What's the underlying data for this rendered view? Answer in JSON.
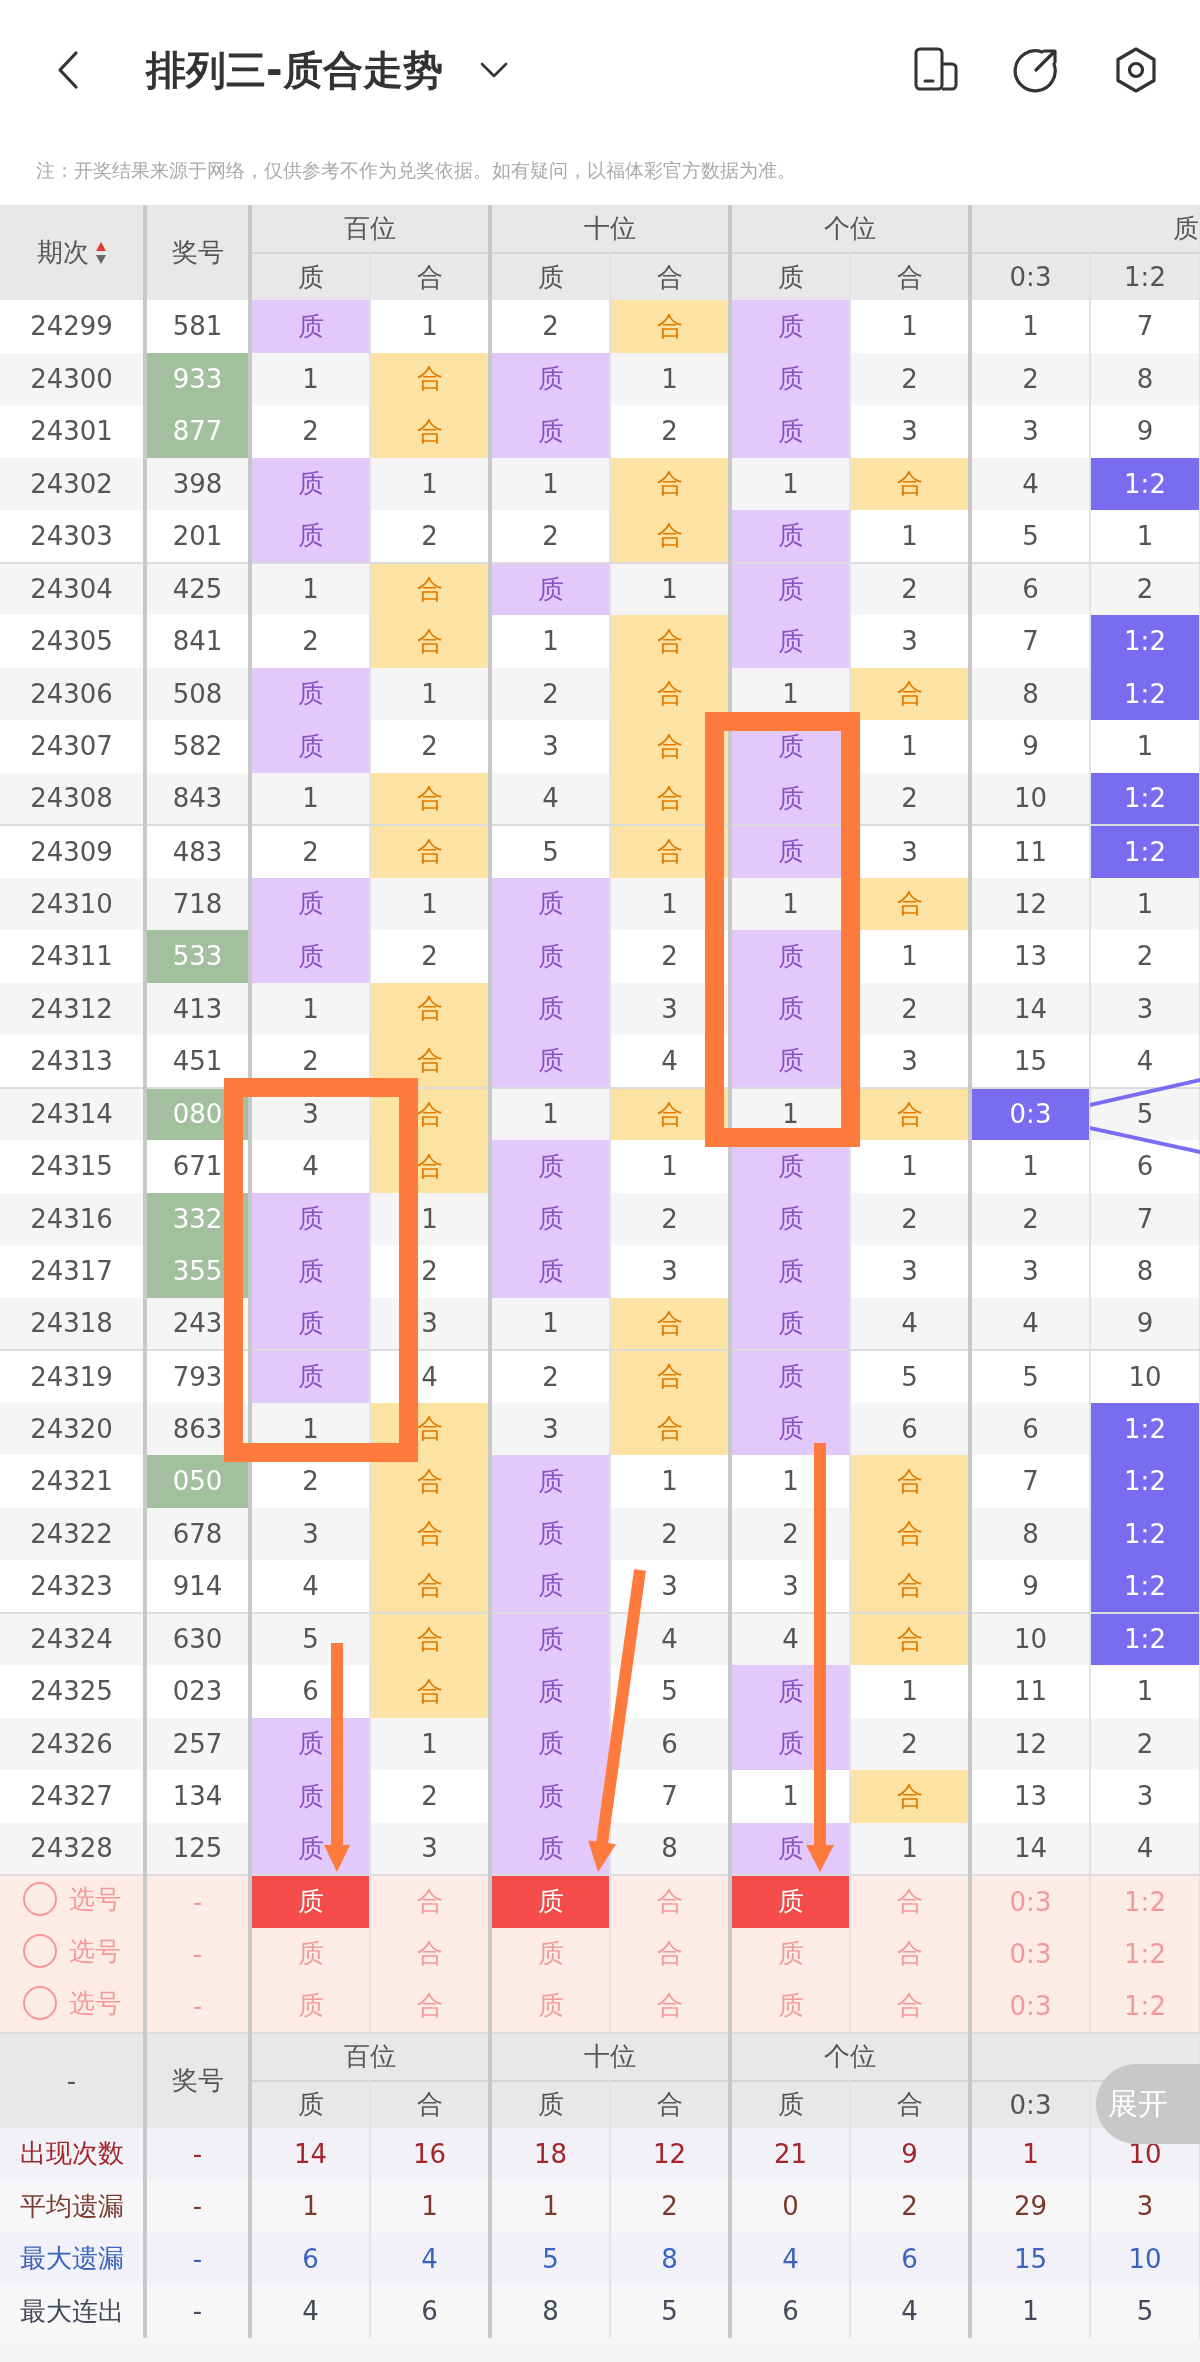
{
  "title": "排列三-质合走势",
  "note": "注：开奖结果来源于网络，仅供参考不作为兑奖依据。如有疑问，以福体彩官方数据为准。",
  "header": {
    "period": "期次",
    "prize": "奖号",
    "groups": [
      "百位",
      "十位",
      "个位"
    ],
    "ratio_group": "质",
    "sub": [
      "质",
      "合",
      "质",
      "合",
      "质",
      "合",
      "0:3",
      "1:2"
    ]
  },
  "rows": [
    {
      "period": "24299",
      "prize": "581",
      "pair": false,
      "pos": [
        {
          "kind": "prime",
          "prime": "质",
          "composite": "1"
        },
        {
          "kind": "composite",
          "prime": "2",
          "composite": "合"
        },
        {
          "kind": "prime",
          "prime": "质",
          "composite": "1"
        }
      ],
      "ratio": [
        {
          "text": "1",
          "selected": false
        },
        {
          "text": "7",
          "selected": false
        }
      ]
    },
    {
      "period": "24300",
      "prize": "933",
      "pair": true,
      "pos": [
        {
          "kind": "composite",
          "prime": "1",
          "composite": "合"
        },
        {
          "kind": "prime",
          "prime": "质",
          "composite": "1"
        },
        {
          "kind": "prime",
          "prime": "质",
          "composite": "2"
        }
      ],
      "ratio": [
        {
          "text": "2",
          "selected": false
        },
        {
          "text": "8",
          "selected": false
        }
      ]
    },
    {
      "period": "24301",
      "prize": "877",
      "pair": true,
      "pos": [
        {
          "kind": "composite",
          "prime": "2",
          "composite": "合"
        },
        {
          "kind": "prime",
          "prime": "质",
          "composite": "2"
        },
        {
          "kind": "prime",
          "prime": "质",
          "composite": "3"
        }
      ],
      "ratio": [
        {
          "text": "3",
          "selected": false
        },
        {
          "text": "9",
          "selected": false
        }
      ]
    },
    {
      "period": "24302",
      "prize": "398",
      "pair": false,
      "pos": [
        {
          "kind": "prime",
          "prime": "质",
          "composite": "1"
        },
        {
          "kind": "composite",
          "prime": "1",
          "composite": "合"
        },
        {
          "kind": "composite",
          "prime": "1",
          "composite": "合"
        }
      ],
      "ratio": [
        {
          "text": "4",
          "selected": false
        },
        {
          "text": "1:2",
          "selected": true
        }
      ]
    },
    {
      "period": "24303",
      "prize": "201",
      "pair": false,
      "pos": [
        {
          "kind": "prime",
          "prime": "质",
          "composite": "2"
        },
        {
          "kind": "composite",
          "prime": "2",
          "composite": "合"
        },
        {
          "kind": "prime",
          "prime": "质",
          "composite": "1"
        }
      ],
      "ratio": [
        {
          "text": "5",
          "selected": false
        },
        {
          "text": "1",
          "selected": false
        }
      ]
    },
    {
      "period": "24304",
      "prize": "425",
      "pair": false,
      "pos": [
        {
          "kind": "composite",
          "prime": "1",
          "composite": "合"
        },
        {
          "kind": "prime",
          "prime": "质",
          "composite": "1"
        },
        {
          "kind": "prime",
          "prime": "质",
          "composite": "2"
        }
      ],
      "ratio": [
        {
          "text": "6",
          "selected": false
        },
        {
          "text": "2",
          "selected": false
        }
      ]
    },
    {
      "period": "24305",
      "prize": "841",
      "pair": false,
      "pos": [
        {
          "kind": "composite",
          "prime": "2",
          "composite": "合"
        },
        {
          "kind": "composite",
          "prime": "1",
          "composite": "合"
        },
        {
          "kind": "prime",
          "prime": "质",
          "composite": "3"
        }
      ],
      "ratio": [
        {
          "text": "7",
          "selected": false
        },
        {
          "text": "1:2",
          "selected": true
        }
      ]
    },
    {
      "period": "24306",
      "prize": "508",
      "pair": false,
      "pos": [
        {
          "kind": "prime",
          "prime": "质",
          "composite": "1"
        },
        {
          "kind": "composite",
          "prime": "2",
          "composite": "合"
        },
        {
          "kind": "composite",
          "prime": "1",
          "composite": "合"
        }
      ],
      "ratio": [
        {
          "text": "8",
          "selected": false
        },
        {
          "text": "1:2",
          "selected": true
        }
      ]
    },
    {
      "period": "24307",
      "prize": "582",
      "pair": false,
      "pos": [
        {
          "kind": "prime",
          "prime": "质",
          "composite": "2"
        },
        {
          "kind": "composite",
          "prime": "3",
          "composite": "合"
        },
        {
          "kind": "prime",
          "prime": "质",
          "composite": "1"
        }
      ],
      "ratio": [
        {
          "text": "9",
          "selected": false
        },
        {
          "text": "1",
          "selected": false
        }
      ]
    },
    {
      "period": "24308",
      "prize": "843",
      "pair": false,
      "pos": [
        {
          "kind": "composite",
          "prime": "1",
          "composite": "合"
        },
        {
          "kind": "composite",
          "prime": "4",
          "composite": "合"
        },
        {
          "kind": "prime",
          "prime": "质",
          "composite": "2"
        }
      ],
      "ratio": [
        {
          "text": "10",
          "selected": false
        },
        {
          "text": "1:2",
          "selected": true
        }
      ]
    },
    {
      "period": "24309",
      "prize": "483",
      "pair": false,
      "pos": [
        {
          "kind": "composite",
          "prime": "2",
          "composite": "合"
        },
        {
          "kind": "composite",
          "prime": "5",
          "composite": "合"
        },
        {
          "kind": "prime",
          "prime": "质",
          "composite": "3"
        }
      ],
      "ratio": [
        {
          "text": "11",
          "selected": false
        },
        {
          "text": "1:2",
          "selected": true
        }
      ]
    },
    {
      "period": "24310",
      "prize": "718",
      "pair": false,
      "pos": [
        {
          "kind": "prime",
          "prime": "质",
          "composite": "1"
        },
        {
          "kind": "prime",
          "prime": "质",
          "composite": "1"
        },
        {
          "kind": "composite",
          "prime": "1",
          "composite": "合"
        }
      ],
      "ratio": [
        {
          "text": "12",
          "selected": false
        },
        {
          "text": "1",
          "selected": false
        }
      ]
    },
    {
      "period": "24311",
      "prize": "533",
      "pair": true,
      "pos": [
        {
          "kind": "prime",
          "prime": "质",
          "composite": "2"
        },
        {
          "kind": "prime",
          "prime": "质",
          "composite": "2"
        },
        {
          "kind": "prime",
          "prime": "质",
          "composite": "1"
        }
      ],
      "ratio": [
        {
          "text": "13",
          "selected": false
        },
        {
          "text": "2",
          "selected": false
        }
      ]
    },
    {
      "period": "24312",
      "prize": "413",
      "pair": false,
      "pos": [
        {
          "kind": "composite",
          "prime": "1",
          "composite": "合"
        },
        {
          "kind": "prime",
          "prime": "质",
          "composite": "3"
        },
        {
          "kind": "prime",
          "prime": "质",
          "composite": "2"
        }
      ],
      "ratio": [
        {
          "text": "14",
          "selected": false
        },
        {
          "text": "3",
          "selected": false
        }
      ]
    },
    {
      "period": "24313",
      "prize": "451",
      "pair": false,
      "pos": [
        {
          "kind": "composite",
          "prime": "2",
          "composite": "合"
        },
        {
          "kind": "prime",
          "prime": "质",
          "composite": "4"
        },
        {
          "kind": "prime",
          "prime": "质",
          "composite": "3"
        }
      ],
      "ratio": [
        {
          "text": "15",
          "selected": false
        },
        {
          "text": "4",
          "selected": false
        }
      ]
    },
    {
      "period": "24314",
      "prize": "080",
      "pair": true,
      "pos": [
        {
          "kind": "composite",
          "prime": "3",
          "composite": "合"
        },
        {
          "kind": "composite",
          "prime": "1",
          "composite": "合"
        },
        {
          "kind": "composite",
          "prime": "1",
          "composite": "合"
        }
      ],
      "ratio": [
        {
          "text": "0:3",
          "selected": true
        },
        {
          "text": "5",
          "selected": false
        }
      ]
    },
    {
      "period": "24315",
      "prize": "671",
      "pair": false,
      "pos": [
        {
          "kind": "composite",
          "prime": "4",
          "composite": "合"
        },
        {
          "kind": "prime",
          "prime": "质",
          "composite": "1"
        },
        {
          "kind": "prime",
          "prime": "质",
          "composite": "1"
        }
      ],
      "ratio": [
        {
          "text": "1",
          "selected": false
        },
        {
          "text": "6",
          "selected": false
        }
      ]
    },
    {
      "period": "24316",
      "prize": "332",
      "pair": true,
      "pos": [
        {
          "kind": "prime",
          "prime": "质",
          "composite": "1"
        },
        {
          "kind": "prime",
          "prime": "质",
          "composite": "2"
        },
        {
          "kind": "prime",
          "prime": "质",
          "composite": "2"
        }
      ],
      "ratio": [
        {
          "text": "2",
          "selected": false
        },
        {
          "text": "7",
          "selected": false
        }
      ]
    },
    {
      "period": "24317",
      "prize": "355",
      "pair": true,
      "pos": [
        {
          "kind": "prime",
          "prime": "质",
          "composite": "2"
        },
        {
          "kind": "prime",
          "prime": "质",
          "composite": "3"
        },
        {
          "kind": "prime",
          "prime": "质",
          "composite": "3"
        }
      ],
      "ratio": [
        {
          "text": "3",
          "selected": false
        },
        {
          "text": "8",
          "selected": false
        }
      ]
    },
    {
      "period": "24318",
      "prize": "243",
      "pair": false,
      "pos": [
        {
          "kind": "prime",
          "prime": "质",
          "composite": "3"
        },
        {
          "kind": "composite",
          "prime": "1",
          "composite": "合"
        },
        {
          "kind": "prime",
          "prime": "质",
          "composite": "4"
        }
      ],
      "ratio": [
        {
          "text": "4",
          "selected": false
        },
        {
          "text": "9",
          "selected": false
        }
      ]
    },
    {
      "period": "24319",
      "prize": "793",
      "pair": false,
      "pos": [
        {
          "kind": "prime",
          "prime": "质",
          "composite": "4"
        },
        {
          "kind": "composite",
          "prime": "2",
          "composite": "合"
        },
        {
          "kind": "prime",
          "prime": "质",
          "composite": "5"
        }
      ],
      "ratio": [
        {
          "text": "5",
          "selected": false
        },
        {
          "text": "10",
          "selected": false
        }
      ]
    },
    {
      "period": "24320",
      "prize": "863",
      "pair": false,
      "pos": [
        {
          "kind": "composite",
          "prime": "1",
          "composite": "合"
        },
        {
          "kind": "composite",
          "prime": "3",
          "composite": "合"
        },
        {
          "kind": "prime",
          "prime": "质",
          "composite": "6"
        }
      ],
      "ratio": [
        {
          "text": "6",
          "selected": false
        },
        {
          "text": "1:2",
          "selected": true
        }
      ]
    },
    {
      "period": "24321",
      "prize": "050",
      "pair": true,
      "pos": [
        {
          "kind": "composite",
          "prime": "2",
          "composite": "合"
        },
        {
          "kind": "prime",
          "prime": "质",
          "composite": "1"
        },
        {
          "kind": "composite",
          "prime": "1",
          "composite": "合"
        }
      ],
      "ratio": [
        {
          "text": "7",
          "selected": false
        },
        {
          "text": "1:2",
          "selected": true
        }
      ]
    },
    {
      "period": "24322",
      "prize": "678",
      "pair": false,
      "pos": [
        {
          "kind": "composite",
          "prime": "3",
          "composite": "合"
        },
        {
          "kind": "prime",
          "prime": "质",
          "composite": "2"
        },
        {
          "kind": "composite",
          "prime": "2",
          "composite": "合"
        }
      ],
      "ratio": [
        {
          "text": "8",
          "selected": false
        },
        {
          "text": "1:2",
          "selected": true
        }
      ]
    },
    {
      "period": "24323",
      "prize": "914",
      "pair": false,
      "pos": [
        {
          "kind": "composite",
          "prime": "4",
          "composite": "合"
        },
        {
          "kind": "prime",
          "prime": "质",
          "composite": "3"
        },
        {
          "kind": "composite",
          "prime": "3",
          "composite": "合"
        }
      ],
      "ratio": [
        {
          "text": "9",
          "selected": false
        },
        {
          "text": "1:2",
          "selected": true
        }
      ]
    },
    {
      "period": "24324",
      "prize": "630",
      "pair": false,
      "pos": [
        {
          "kind": "composite",
          "prime": "5",
          "composite": "合"
        },
        {
          "kind": "prime",
          "prime": "质",
          "composite": "4"
        },
        {
          "kind": "composite",
          "prime": "4",
          "composite": "合"
        }
      ],
      "ratio": [
        {
          "text": "10",
          "selected": false
        },
        {
          "text": "1:2",
          "selected": true
        }
      ]
    },
    {
      "period": "24325",
      "prize": "023",
      "pair": false,
      "pos": [
        {
          "kind": "composite",
          "prime": "6",
          "composite": "合"
        },
        {
          "kind": "prime",
          "prime": "质",
          "composite": "5"
        },
        {
          "kind": "prime",
          "prime": "质",
          "composite": "1"
        }
      ],
      "ratio": [
        {
          "text": "11",
          "selected": false
        },
        {
          "text": "1",
          "selected": false
        }
      ]
    },
    {
      "period": "24326",
      "prize": "257",
      "pair": false,
      "pos": [
        {
          "kind": "prime",
          "prime": "质",
          "composite": "1"
        },
        {
          "kind": "prime",
          "prime": "质",
          "composite": "6"
        },
        {
          "kind": "prime",
          "prime": "质",
          "composite": "2"
        }
      ],
      "ratio": [
        {
          "text": "12",
          "selected": false
        },
        {
          "text": "2",
          "selected": false
        }
      ]
    },
    {
      "period": "24327",
      "prize": "134",
      "pair": false,
      "pos": [
        {
          "kind": "prime",
          "prime": "质",
          "composite": "2"
        },
        {
          "kind": "prime",
          "prime": "质",
          "composite": "7"
        },
        {
          "kind": "composite",
          "prime": "1",
          "composite": "合"
        }
      ],
      "ratio": [
        {
          "text": "13",
          "selected": false
        },
        {
          "text": "3",
          "selected": false
        }
      ]
    },
    {
      "period": "24328",
      "prize": "125",
      "pair": false,
      "pos": [
        {
          "kind": "prime",
          "prime": "质",
          "composite": "3"
        },
        {
          "kind": "prime",
          "prime": "质",
          "composite": "8"
        },
        {
          "kind": "prime",
          "prime": "质",
          "composite": "1"
        }
      ],
      "ratio": [
        {
          "text": "14",
          "selected": false
        },
        {
          "text": "4",
          "selected": false
        }
      ]
    }
  ],
  "picks": [
    {
      "label": "选号",
      "prize": "-",
      "cells": [
        {
          "text": "质",
          "selected": true
        },
        {
          "text": "合",
          "selected": false
        },
        {
          "text": "质",
          "selected": true
        },
        {
          "text": "合",
          "selected": false
        },
        {
          "text": "质",
          "selected": true
        },
        {
          "text": "合",
          "selected": false
        },
        {
          "text": "0:3",
          "selected": false
        },
        {
          "text": "1:2",
          "selected": false
        }
      ]
    },
    {
      "label": "选号",
      "prize": "-",
      "cells": [
        {
          "text": "质",
          "selected": false
        },
        {
          "text": "合",
          "selected": false
        },
        {
          "text": "质",
          "selected": false
        },
        {
          "text": "合",
          "selected": false
        },
        {
          "text": "质",
          "selected": false
        },
        {
          "text": "合",
          "selected": false
        },
        {
          "text": "0:3",
          "selected": false
        },
        {
          "text": "1:2",
          "selected": false
        }
      ]
    },
    {
      "label": "选号",
      "prize": "-",
      "cells": [
        {
          "text": "质",
          "selected": false
        },
        {
          "text": "合",
          "selected": false
        },
        {
          "text": "质",
          "selected": false
        },
        {
          "text": "合",
          "selected": false
        },
        {
          "text": "质",
          "selected": false
        },
        {
          "text": "合",
          "selected": false
        },
        {
          "text": "0:3",
          "selected": false
        },
        {
          "text": "1:2",
          "selected": false
        }
      ]
    }
  ],
  "footer_header": {
    "first": "-",
    "prize": "奖号",
    "groups": [
      "百位",
      "十位",
      "个位"
    ],
    "sub": [
      "质",
      "合",
      "质",
      "合",
      "质",
      "合",
      "0:3"
    ]
  },
  "expand_button": "展开",
  "stats": [
    {
      "kind": "count",
      "label": "出现次数",
      "values": [
        "-",
        "14",
        "16",
        "18",
        "12",
        "21",
        "9",
        "1",
        "10"
      ]
    },
    {
      "kind": "avg_miss",
      "label": "平均遗漏",
      "values": [
        "-",
        "1",
        "1",
        "1",
        "2",
        "0",
        "2",
        "29",
        "3"
      ]
    },
    {
      "kind": "max_miss",
      "label": "最大遗漏",
      "values": [
        "-",
        "6",
        "4",
        "5",
        "8",
        "4",
        "6",
        "15",
        "10"
      ]
    },
    {
      "kind": "max_run",
      "label": "最大连出",
      "values": [
        "-",
        "4",
        "6",
        "8",
        "5",
        "6",
        "4",
        "1",
        "5"
      ]
    }
  ]
}
